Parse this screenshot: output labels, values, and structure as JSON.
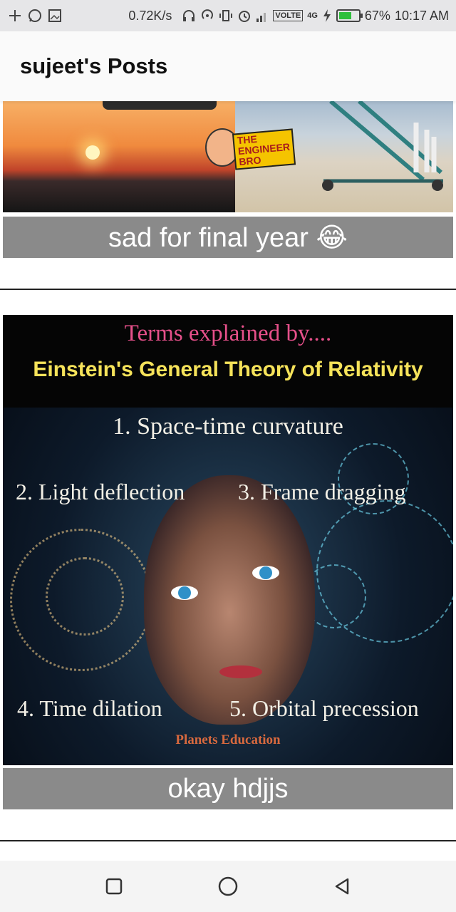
{
  "status_bar": {
    "network_speed": "0.72K/s",
    "volte": "VOLTE",
    "network_type": "4G",
    "battery": "67%",
    "battery_level": 0.67,
    "time": "10:17 AM",
    "icons_left": [
      "plus-icon",
      "whatsapp-icon",
      "gallery-icon"
    ],
    "icons_right": [
      "headphones-icon",
      "hotspot-icon",
      "vibrate-icon",
      "alarm-icon",
      "signal-icon",
      "charging-icon"
    ]
  },
  "header": {
    "title": "sujeet's Posts"
  },
  "posts": [
    {
      "caption": "sad for final year 😂",
      "image": {
        "logo_text": "THE ENGINEER BRO"
      }
    },
    {
      "caption": "okay hdjjs",
      "image": {
        "heading": "Terms explained by....",
        "subheading": "Einstein's General Theory of Relativity",
        "term_1": "1. Space-time curvature",
        "term_2": "2. Light deflection",
        "term_3": "3. Frame dragging",
        "term_4": "4. Time dilation",
        "term_5": "5. Orbital precession",
        "credit": "Planets Education"
      }
    }
  ],
  "navigation": {
    "recents": "recents-square-icon",
    "home": "home-circle-icon",
    "back": "back-triangle-icon"
  },
  "colors": {
    "caption_bg": "#8a8a8a",
    "status_bg": "#e6e6e8",
    "battery_green": "#2fbf3c",
    "terms_pink": "#e6508a",
    "einstein_yellow": "#f6e35a"
  }
}
